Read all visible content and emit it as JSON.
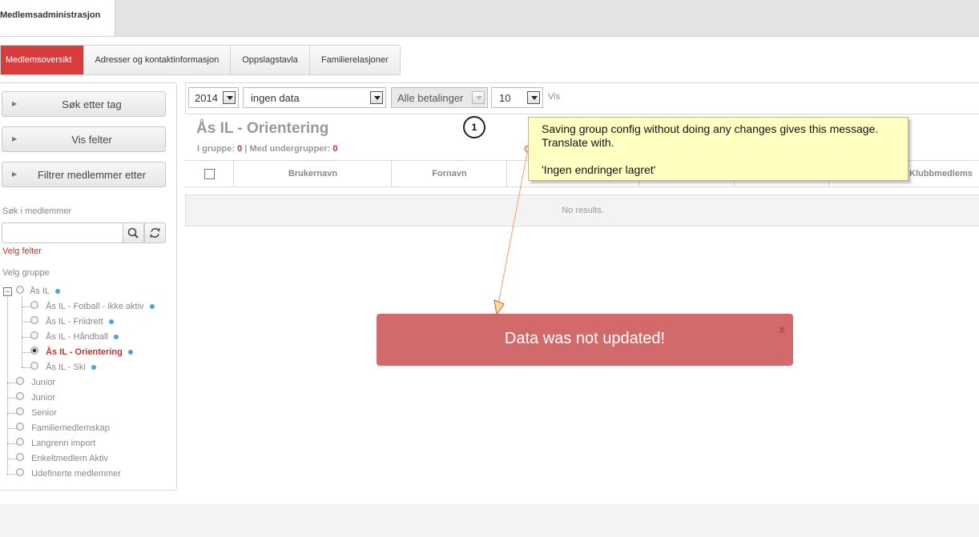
{
  "app": {
    "title": "Medlemsadministrasjon"
  },
  "tabs": [
    {
      "label": "Medlemsoversikt",
      "active": true
    },
    {
      "label": "Adresser og kontaktinformasjon",
      "active": false
    },
    {
      "label": "Oppslagstavla",
      "active": false
    },
    {
      "label": "Familierelasjoner",
      "active": false
    }
  ],
  "sidebar": {
    "buttons": [
      {
        "label": "Søk etter tag"
      },
      {
        "label": "Vis felter"
      },
      {
        "label": "Filtrer medlemmer etter"
      }
    ],
    "search_label": "Søk i medlemmer",
    "search_value": "",
    "velg_felter": "Velg felter",
    "velg_gruppe": "Velg gruppe",
    "tree": [
      {
        "label": "Ås IL",
        "dot": true,
        "checked": false,
        "level": 0,
        "expanded": true
      },
      {
        "label": "Ås IL - Fotball - ikke aktiv",
        "dot": true,
        "checked": false,
        "level": 1
      },
      {
        "label": "Ås IL - Friidrett",
        "dot": true,
        "checked": false,
        "level": 1
      },
      {
        "label": "Ås IL - Håndball",
        "dot": true,
        "checked": false,
        "level": 1
      },
      {
        "label": "Ås IL - Orientering",
        "dot": true,
        "checked": true,
        "level": 1
      },
      {
        "label": "Ås IL - Ski",
        "dot": true,
        "checked": false,
        "level": 1
      },
      {
        "label": "Junior",
        "dot": false,
        "checked": false,
        "level": 0
      },
      {
        "label": "Junior",
        "dot": false,
        "checked": false,
        "level": 0
      },
      {
        "label": "Senior",
        "dot": false,
        "checked": false,
        "level": 0
      },
      {
        "label": "Familiemedlemskap",
        "dot": false,
        "checked": false,
        "level": 0
      },
      {
        "label": "Langrenn import",
        "dot": false,
        "checked": false,
        "level": 0
      },
      {
        "label": "Enkeltmedlem Aktiv",
        "dot": false,
        "checked": false,
        "level": 0
      },
      {
        "label": "Udefinerte medlemmer",
        "dot": false,
        "checked": false,
        "level": 0
      }
    ]
  },
  "toolbar": {
    "year": "2014",
    "data": "ingen data",
    "payments": "Alle betalinger",
    "page_size": "10",
    "vis": "Vis"
  },
  "group": {
    "title": "Ås IL - Orientering",
    "i_gruppe_label": "I gruppe:",
    "i_gruppe_count": "0",
    "sep": "|",
    "med_undergrupper_label": "Med undergrupper:",
    "med_undergrupper_count": "0"
  },
  "table": {
    "columns": [
      "Brukernavn",
      "Fornavn",
      "",
      "",
      "",
      "Klubbmedlems"
    ],
    "empty_text": "No results."
  },
  "annotation": {
    "number": "1",
    "line1": "Saving group config without doing any changes gives this message.",
    "line2": "Translate with.",
    "line3": "'Ingen endringer lagret'"
  },
  "toast": {
    "message": "Data was not updated!",
    "close": "x",
    "color": "#d2696a"
  },
  "colors": {
    "accent": "#d93c3c",
    "tree_dot": "#4ea3d8"
  }
}
